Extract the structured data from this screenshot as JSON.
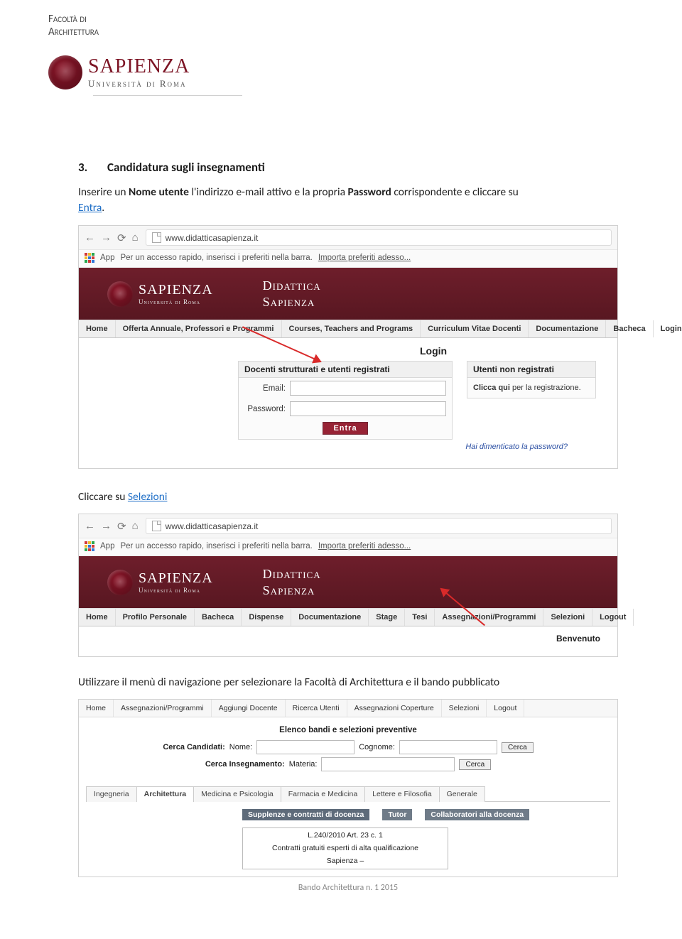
{
  "letterhead": {
    "faculty_line1": "Facoltà di",
    "faculty_line2": "Architettura",
    "sapienza_big": "SAPIENZA",
    "sapienza_sub": "Università di Roma"
  },
  "section": {
    "number": "3.",
    "title": "Candidatura sugli insegnamenti"
  },
  "para1": {
    "pre": "Inserire un ",
    "bold1": "Nome utente",
    "mid": " l'indirizzo e-mail attivo e la propria ",
    "bold2": "Password",
    "after": " corrispondente e cliccare su ",
    "link": "Entra",
    "tail": "."
  },
  "browser": {
    "url": "www.didatticasapienza.it",
    "apps_label": "App",
    "bookmark_text": "Per un accesso rapido, inserisci i preferiti nella barra.",
    "import_link": "Importa preferiti adesso..."
  },
  "site": {
    "sapienza": "SAPIENZA",
    "sapienza_sub": "Università di Roma",
    "didattica_l1": "Didattica",
    "didattica_l2": "Sapienza"
  },
  "menu1": [
    "Home",
    "Offerta Annuale, Professori e Programmi",
    "Courses, Teachers and Programs",
    "Curriculum Vitae Docenti",
    "Documentazione",
    "Bacheca",
    "Login"
  ],
  "login": {
    "title": "Login",
    "panel_head": "Docenti strutturati e utenti registrati",
    "email_label": "Email:",
    "pw_label": "Password:",
    "entra": "Entra",
    "reg_head": "Utenti non registrati",
    "reg_bold": "Clicca qui",
    "reg_rest": " per la registrazione.",
    "forgot": "Hai dimenticato la password?"
  },
  "instruction2": {
    "pre": "Cliccare su ",
    "link": "Selezioni"
  },
  "menu2": [
    "Home",
    "Profilo Personale",
    "Bacheca",
    "Dispense",
    "Documentazione",
    "Stage",
    "Tesi",
    "Assegnazioni/Programmi",
    "Selezioni",
    "Logout"
  ],
  "welcome": "Benvenuto",
  "instruction3": "Utilizzare il menù di navigazione per selezionare la Facoltà di Architettura e il bando pubblicato",
  "sel": {
    "menu": [
      "Home",
      "Assegnazioni/Programmi",
      "Aggiungi Docente",
      "Ricerca Utenti",
      "Assegnazioni Coperture",
      "Selezioni",
      "Logout"
    ],
    "heading": "Elenco bandi e selezioni preventive",
    "search1_label": "Cerca Candidati:",
    "nome_label": "Nome:",
    "cognome_label": "Cognome:",
    "search2_label": "Cerca Insegnamento:",
    "materia_label": "Materia:",
    "cerca_btn": "Cerca",
    "tabs": [
      "Ingegneria",
      "Architettura",
      "Medicina e Psicologia",
      "Farmacia e Medicina",
      "Lettere e Filosofia",
      "Generale"
    ],
    "pills": [
      "Supplenze e contratti di docenza",
      "Tutor",
      "Collaboratori alla docenza"
    ],
    "box_line1": "L.240/2010 Art. 23 c. 1",
    "box_line2": "Contratti gratuiti esperti di alta qualificazione",
    "box_line3": "Sapienza –"
  },
  "footer": "Bando Architettura n. 1 2015"
}
